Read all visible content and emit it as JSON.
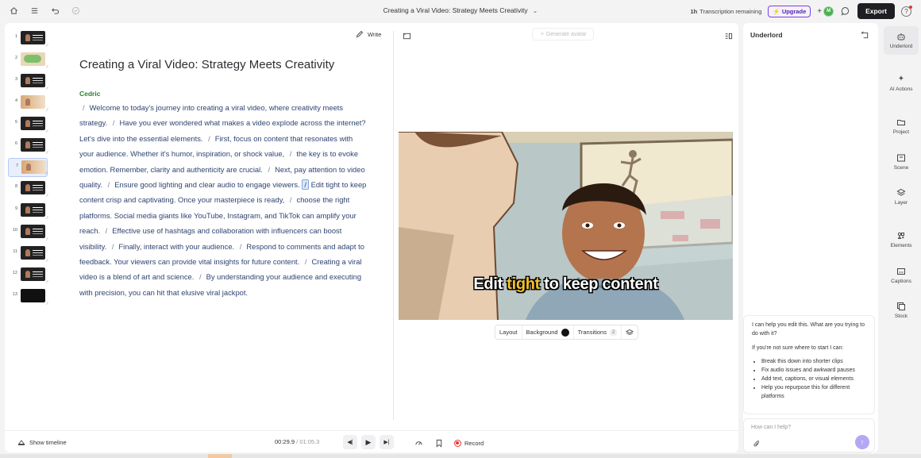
{
  "header": {
    "title": "Creating a Viral Video: Strategy Meets Creativity",
    "transcription_badge": "1h",
    "transcription_label": "Transcription remaining",
    "upgrade_label": "Upgrade",
    "avatar_initial": "M",
    "export_label": "Export"
  },
  "thumbnails": [
    "1",
    "2",
    "3",
    "4",
    "5",
    "6",
    "7",
    "8",
    "9",
    "10",
    "11",
    "12",
    "13"
  ],
  "editor": {
    "write_label": "Write",
    "doc_title": "Creating a Viral Video: Strategy Meets Creativity",
    "speaker": "Cedric",
    "sentences": [
      "Welcome to today's journey into creating a viral video, where creativity meets strategy.",
      "Have you ever wondered what makes a video explode across the internet? Let's dive into the essential elements.",
      "First, focus on content that resonates with your audience. Whether it's humor, inspiration, or shock value,",
      "the key is to evoke emotion. Remember, clarity and authenticity are crucial.",
      "Next, pay attention to video quality.",
      "Ensure good lighting and clear audio to engage viewers.",
      "Edit tight to keep content crisp and captivating. Once your masterpiece is ready,",
      "choose the right platforms. Social media giants like YouTube, Instagram, and TikTok can amplify your reach.",
      "Effective use of hashtags and collaboration with influencers can boost visibility.",
      "Finally, interact with your audience.",
      "Respond to comments and adapt to feedback. Your viewers can provide vital insights for future content.",
      "Creating a viral video is a blend of art and science.",
      "By understanding your audience and executing with precision, you can hit that elusive viral jackpot."
    ],
    "separator": "/"
  },
  "canvas": {
    "generate_avatar_label": "Generate avatar",
    "caption_pre": "Edit ",
    "caption_highlight": "tight",
    "caption_post": " to keep content",
    "layout_label": "Layout",
    "background_label": "Background",
    "transitions_label": "Transitions",
    "transitions_count": "2"
  },
  "bottombar": {
    "show_timeline_label": "Show timeline",
    "current_time": "00:29.9",
    "time_separator": "/",
    "total_time": "01:05.3",
    "record_label": "Record"
  },
  "underlord": {
    "title": "Underlord",
    "intro": "I can help you edit this. What are you trying to do with it?",
    "prompt": "If you're not sure where to start I can:",
    "suggestions": [
      "Break this down into shorter clips",
      "Fix audio issues and awkward pauses",
      "Add text, captions, or visual elements",
      "Help you repurpose this for different platforms"
    ],
    "input_placeholder": "How can I help?"
  },
  "rail": [
    {
      "label": "Underlord",
      "icon": "robot-icon",
      "active": true
    },
    {
      "label": "AI Actions",
      "icon": "sparkle-icon"
    },
    {
      "label": "Project",
      "icon": "folder-icon"
    },
    {
      "label": "Scene",
      "icon": "scene-icon"
    },
    {
      "label": "Layer",
      "icon": "layers-icon"
    },
    {
      "label": "Elements",
      "icon": "elements-icon"
    },
    {
      "label": "Captions",
      "icon": "captions-icon"
    },
    {
      "label": "Stock",
      "icon": "stock-icon"
    }
  ],
  "colors": {
    "accent": "#7c3aed",
    "speaker": "#2e7d32",
    "transcript": "#2f4472",
    "caption_highlight": "#f4c02a",
    "record": "#e53935"
  }
}
